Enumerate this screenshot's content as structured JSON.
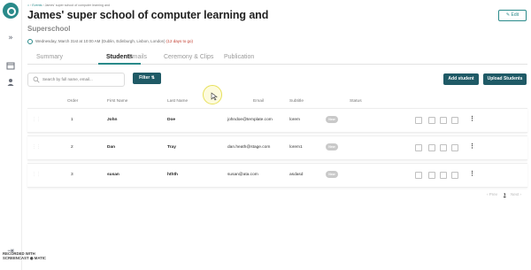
{
  "breadcrumb": {
    "home": "⌂",
    "events": "Events",
    "current": "James' super school of computer learning and"
  },
  "header": {
    "title_line1": "James' super school of computer learning and",
    "title_line2": "Superschool",
    "edit_label": "Edit",
    "datetime": "Wednesday, March 31st at 10:00 AM (Dublin, Edinburgh, Lisbon, London)",
    "days_to_go": "(12 days to go)"
  },
  "tabs": [
    "Summary",
    "Students",
    "Emails",
    "Ceremony & Clips",
    "Publication"
  ],
  "active_tab": "Students",
  "toolbar": {
    "search_placeholder": "Search by full name, email...",
    "filter_label": "Filter",
    "add_student_label": "Add student",
    "upload_students_label": "Upload Students"
  },
  "table": {
    "columns": [
      "Order",
      "First Name",
      "Last Name",
      "Email",
      "Subtitle",
      "Status"
    ],
    "rows": [
      {
        "order": "1",
        "first": "John",
        "last": "Doe",
        "email": "johndoe@template.com",
        "subtitle": "lorem",
        "status": "New"
      },
      {
        "order": "2",
        "first": "Dan",
        "last": "Tray",
        "email": "dan.heath@stage.com",
        "subtitle": "lorem1",
        "status": "New"
      },
      {
        "order": "3",
        "first": "susan",
        "last": "hthth",
        "email": "susan@ata.com",
        "subtitle": "asdasd",
        "status": "New"
      }
    ]
  },
  "pagination": {
    "prev": "‹ Prev",
    "page": "1",
    "next": "Next ›"
  },
  "watermark": {
    "line1": "RECORDED WITH",
    "line2": "SCREENCAST ◉ MATIC"
  },
  "colors": {
    "accent": "#2a8a8a",
    "button_dark": "#1f5a66",
    "deadline": "#c0392b",
    "badge": "#c9c9c9"
  }
}
